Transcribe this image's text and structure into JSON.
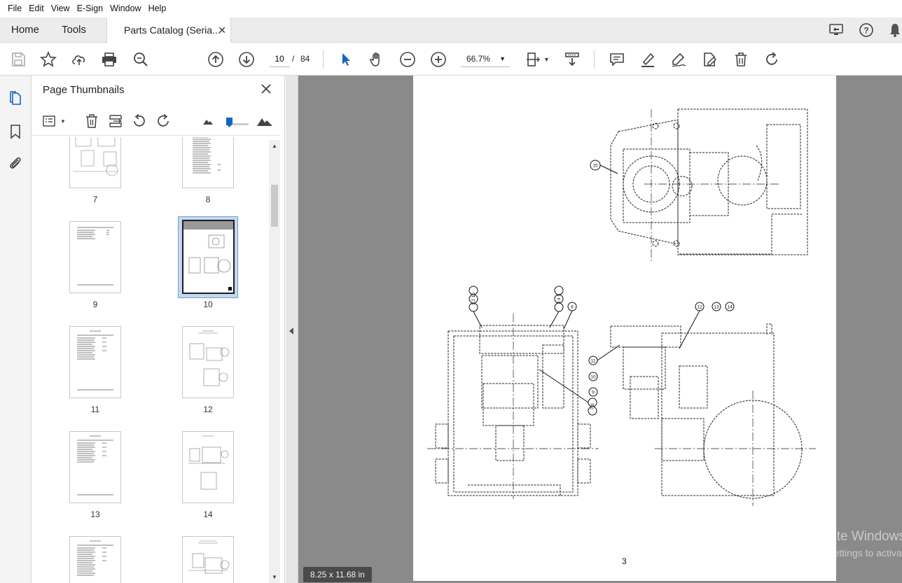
{
  "menu": [
    "File",
    "Edit",
    "View",
    "E-Sign",
    "Window",
    "Help"
  ],
  "tabs": {
    "home": "Home",
    "tools": "Tools",
    "document": "Parts Catalog (Seria...",
    "close_symbol": "✕"
  },
  "toolbar": {
    "page_current": "10",
    "page_separator": "/",
    "page_total": "84",
    "zoom": "66.7%"
  },
  "thumbnails": {
    "title": "Page Thumbnails",
    "pages": [
      "7",
      "8",
      "9",
      "10",
      "11",
      "12",
      "13",
      "14"
    ],
    "selected_page": "10"
  },
  "document": {
    "page_number_text": "3",
    "page_size": "8.25 x 11.68 in",
    "callouts_top": [
      "15"
    ],
    "callouts_left": [
      "1 2 16",
      "3 4 5",
      "6",
      "7 8"
    ],
    "callouts_right": [
      "12",
      "13",
      "14",
      "11",
      "10",
      "9"
    ]
  },
  "watermark": {
    "line1": "Activate Windows",
    "line2": "Go to Settings to activate Windows."
  },
  "icons": {
    "toolbar": [
      "save-icon",
      "bookmark-star-icon",
      "upload-icon",
      "print-icon",
      "zoom-search-icon",
      "page-up-icon",
      "page-down-icon",
      "select-cursor-icon",
      "hand-icon",
      "zoom-out-icon",
      "zoom-in-icon",
      "fit-page-icon",
      "scroll-mode-icon",
      "comment-icon",
      "highlight-icon",
      "sign-icon",
      "edit-pdf-icon",
      "delete-icon",
      "rotate-icon"
    ]
  }
}
